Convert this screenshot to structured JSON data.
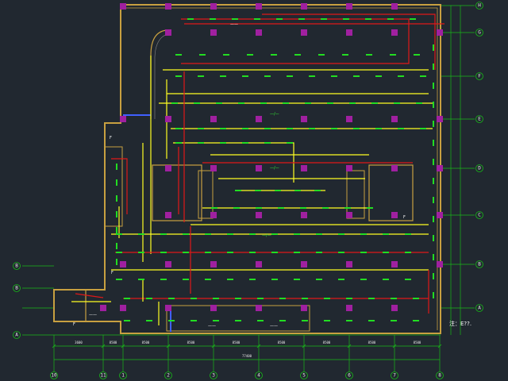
{
  "colors": {
    "background": "#212830",
    "wall": "#c8a040",
    "column": "#a020a0",
    "fixture": "#22dd22",
    "circuit_yellow": "#ffff22",
    "circuit_red": "#e01818",
    "axis": "#18b818",
    "text": "#e8e8e8"
  },
  "axes": {
    "vertical": [
      "H",
      "G",
      "F",
      "E",
      "D",
      "C",
      "B",
      "A"
    ],
    "horizontal": [
      "10",
      "11",
      "1",
      "2",
      "3",
      "4",
      "5",
      "6",
      "7",
      "8"
    ],
    "left_labels": [
      "B",
      "B",
      "A"
    ]
  },
  "dimensions": {
    "bottom": [
      "3600",
      "8500",
      "8500",
      "8500",
      "8500",
      "8500",
      "8500",
      "8500",
      "8500"
    ],
    "total": "77400"
  },
  "labels": {
    "note": "注：E??."
  }
}
